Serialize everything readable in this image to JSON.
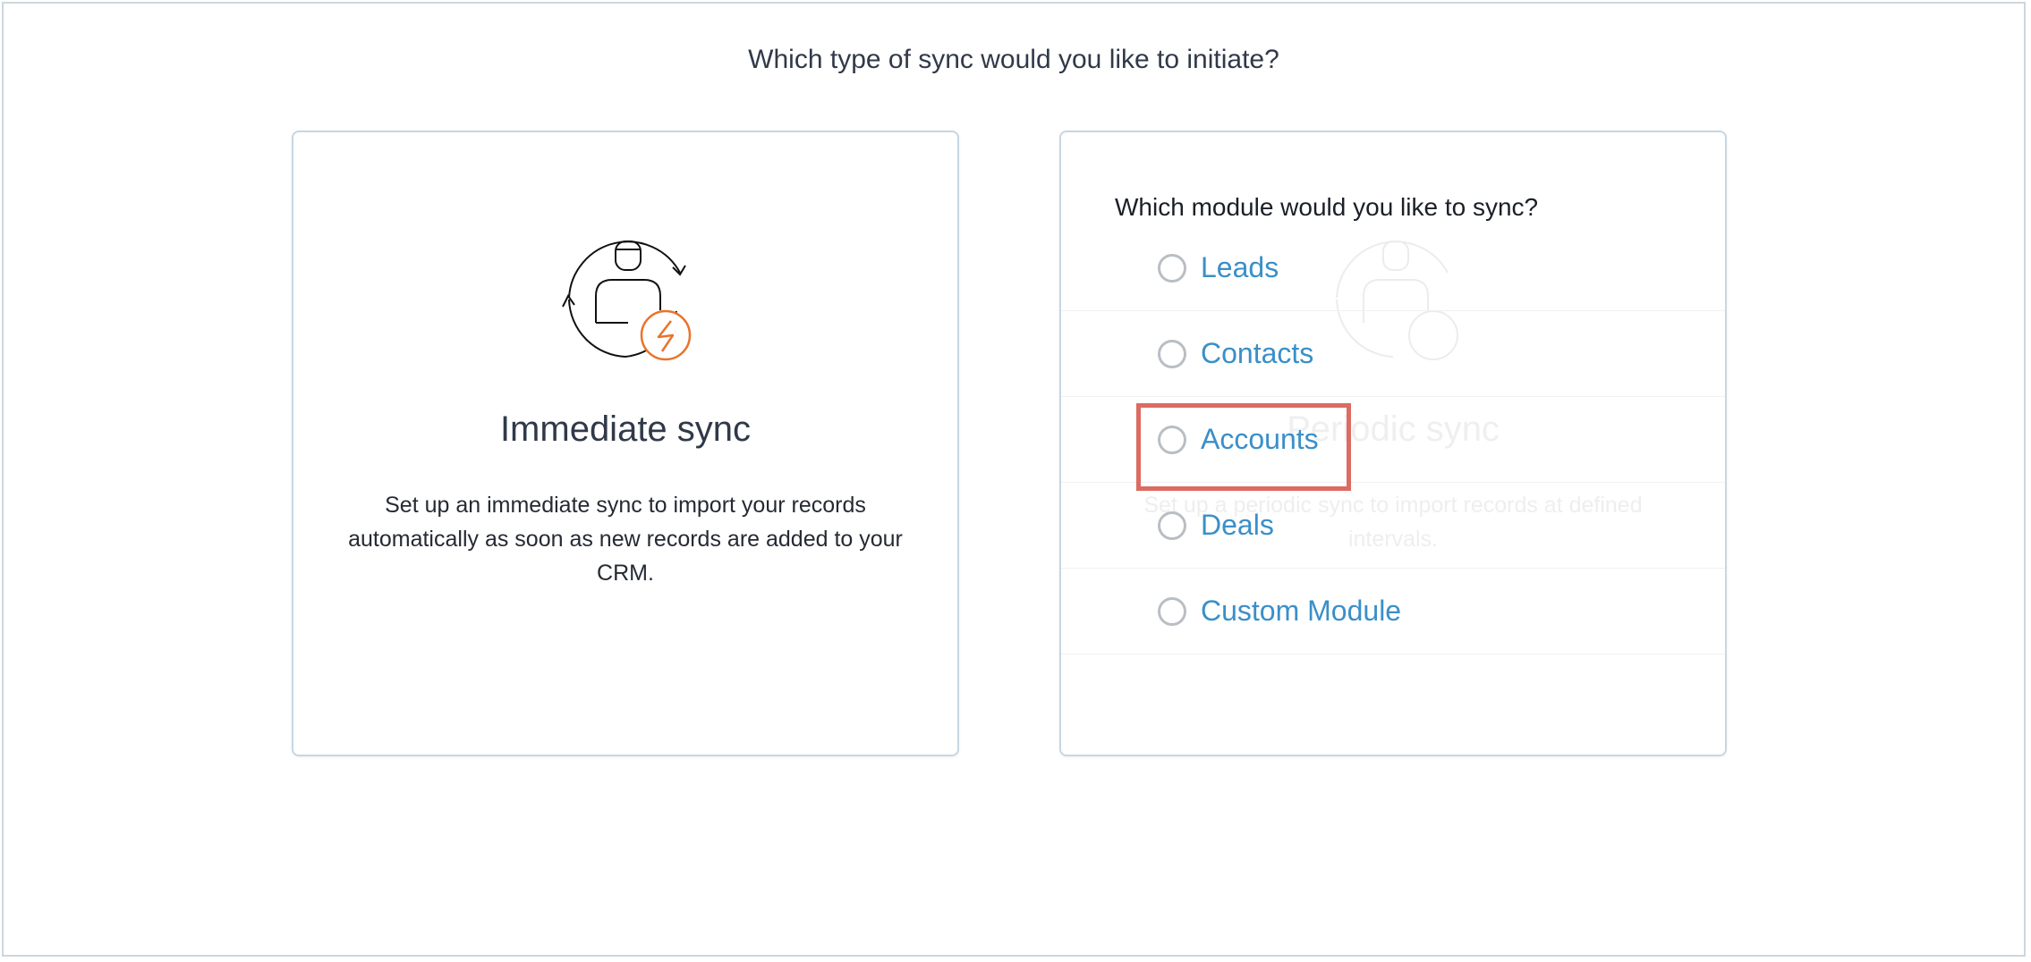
{
  "page": {
    "title": "Which type of sync would you like to initiate?"
  },
  "immediate": {
    "heading": "Immediate sync",
    "description": "Set up an immediate sync to import your records automatically as soon as new records are added to your CRM."
  },
  "periodic": {
    "heading": "Periodic sync",
    "description": "Set up a periodic sync to import records at defined intervals."
  },
  "module_picker": {
    "question": "Which module would you like to sync?",
    "options": [
      "Leads",
      "Contacts",
      "Accounts",
      "Deals",
      "Custom Module"
    ]
  },
  "colors": {
    "accent_link": "#3a8fc9",
    "bolt_orange": "#e8742c",
    "highlight": "#dc6b62"
  },
  "icons": {
    "immediate": "user-sync-bolt-icon",
    "periodic": "user-sync-clock-icon"
  }
}
